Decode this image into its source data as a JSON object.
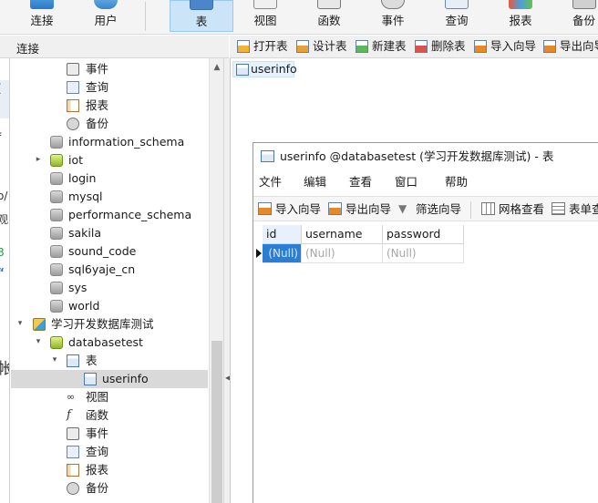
{
  "ribbon": {
    "buttons": [
      {
        "label": "连接"
      },
      {
        "label": "用户"
      },
      {
        "label": "表"
      },
      {
        "label": "视图"
      },
      {
        "label": "函数"
      },
      {
        "label": "事件"
      },
      {
        "label": "查询"
      },
      {
        "label": "报表"
      },
      {
        "label": "备份"
      }
    ],
    "active": "表"
  },
  "left_panel": {
    "title": "连接",
    "edge_fragments": [
      "(",
      "f",
      "o/",
      "观",
      "8",
      "“",
      "帐"
    ],
    "tree": [
      {
        "label": "事件",
        "icon": "event-icon"
      },
      {
        "label": "查询",
        "icon": "query-icon"
      },
      {
        "label": "报表",
        "icon": "report-icon"
      },
      {
        "label": "备份",
        "icon": "backup-icon"
      },
      {
        "label": "information_schema",
        "icon": "database-icon"
      },
      {
        "label": "iot",
        "icon": "database-icon"
      },
      {
        "label": "login",
        "icon": "database-icon"
      },
      {
        "label": "mysql",
        "icon": "database-icon"
      },
      {
        "label": "performance_schema",
        "icon": "database-icon"
      },
      {
        "label": "sakila",
        "icon": "database-icon"
      },
      {
        "label": "sound_code",
        "icon": "database-icon"
      },
      {
        "label": "sql6yaje_cn",
        "icon": "database-icon"
      },
      {
        "label": "sys",
        "icon": "database-icon"
      },
      {
        "label": "world",
        "icon": "database-icon"
      },
      {
        "label": "学习开发数据库测试",
        "icon": "connection-icon"
      },
      {
        "label": "databasetest",
        "icon": "database-icon"
      },
      {
        "label": "表",
        "icon": "table-icon"
      },
      {
        "label": "userinfo",
        "icon": "table-icon"
      },
      {
        "label": "视图",
        "icon": "view-icon"
      },
      {
        "label": "函数",
        "icon": "function-icon"
      },
      {
        "label": "事件",
        "icon": "event-icon"
      },
      {
        "label": "查询",
        "icon": "query-icon"
      },
      {
        "label": "报表",
        "icon": "report-icon"
      },
      {
        "label": "备份",
        "icon": "backup-icon"
      }
    ],
    "selected": "userinfo"
  },
  "object_toolbar": {
    "buttons": [
      {
        "label": "打开表"
      },
      {
        "label": "设计表"
      },
      {
        "label": "新建表"
      },
      {
        "label": "删除表"
      },
      {
        "label": "导入向导"
      },
      {
        "label": "导出向导"
      }
    ]
  },
  "objects": {
    "items": [
      {
        "label": "userinfo"
      }
    ]
  },
  "table_window": {
    "title": "userinfo @databasetest (学习开发数据库测试) - 表",
    "menu": [
      "文件",
      "编辑",
      "查看",
      "窗口",
      "帮助"
    ],
    "toolbar": [
      {
        "label": "导入向导"
      },
      {
        "label": "导出向导"
      },
      {
        "label": "筛选向导"
      },
      {
        "label": "网格查看"
      },
      {
        "label": "表单查看"
      }
    ],
    "columns": [
      "id",
      "username",
      "password"
    ],
    "rows": [
      [
        "(Null)",
        "(Null)",
        "(Null)"
      ]
    ]
  },
  "colors": {
    "accent_blue": "#2a7fd4",
    "active_tab": "#cce4f7",
    "database_green": "#8db82a",
    "null_text": "#a6a6a6"
  }
}
